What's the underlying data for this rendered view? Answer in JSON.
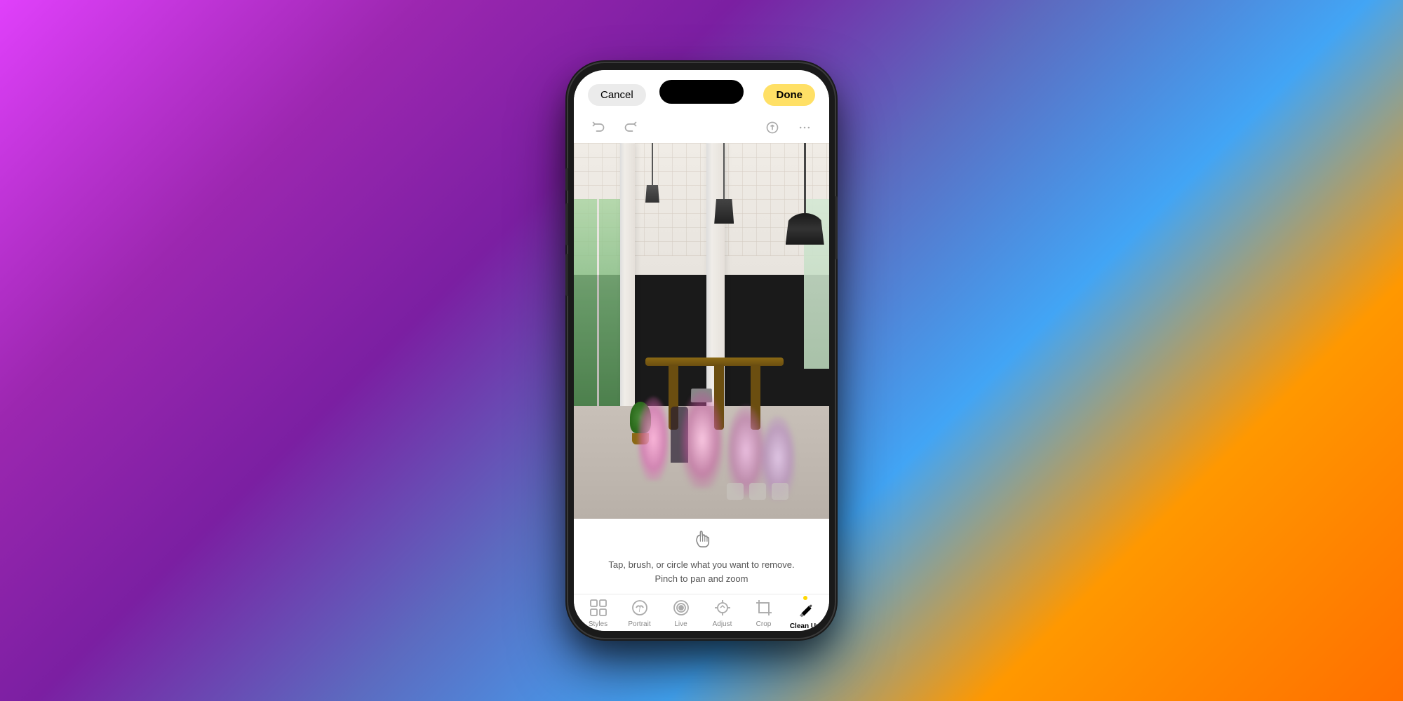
{
  "background": {
    "gradient": "linear-gradient(135deg, #e040fb 0%, #9c27b0 20%, #7b1fa2 35%, #5c6bc0 50%, #42a5f5 65%, #ff9800 80%, #ff6f00 100%)"
  },
  "topBar": {
    "cancelLabel": "Cancel",
    "doneLabel": "Done"
  },
  "instructions": {
    "line1": "Tap, brush, or circle what you want to remove.",
    "line2": "Pinch to pan and zoom"
  },
  "toolbar": {
    "items": [
      {
        "id": "styles",
        "label": "Styles",
        "icon": "grid"
      },
      {
        "id": "portrait",
        "label": "Portrait",
        "icon": "f-icon"
      },
      {
        "id": "live",
        "label": "Live",
        "icon": "circle-dot"
      },
      {
        "id": "adjust",
        "label": "Adjust",
        "icon": "dial"
      },
      {
        "id": "crop",
        "label": "Crop",
        "icon": "crop"
      },
      {
        "id": "cleanup",
        "label": "Clean Up",
        "icon": "eraser",
        "active": true
      }
    ]
  },
  "icons": {
    "undo": "↩",
    "redo": "↪",
    "edit": "A",
    "more": "···"
  }
}
